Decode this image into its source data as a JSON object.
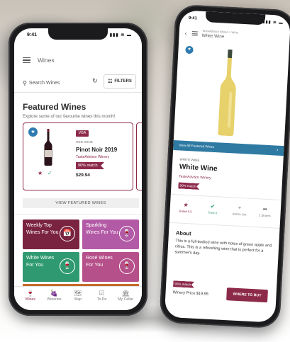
{
  "left_phone": {
    "status": {
      "time": "9:41",
      "icons": "▮▮▮ ≋ ▬"
    },
    "header": {
      "title": "Wines"
    },
    "search": {
      "placeholder": "Search Wines",
      "filters_label": "FILTERS"
    },
    "featured": {
      "title": "Featured Wines",
      "subtitle": "Explore some of our favourite wines this month!",
      "card": {
        "tag": "VGA",
        "type": "RED WINE",
        "name": "Pinot Noir 2019",
        "winery": "TasteAdvisor Winery",
        "match": "90% match",
        "price": "$29.94",
        "bottle_color": "#2b1419"
      },
      "view_button": "VIEW FEATURED WINES"
    },
    "tiles": [
      {
        "label": "Weekly Top Wines For You",
        "icon": "calendar-icon",
        "glyph": "📅",
        "color": "#7a2340"
      },
      {
        "label": "Sparkling Wines For You",
        "icon": "wine-glass-icon",
        "glyph": "🍷",
        "color": "#b35aa6"
      },
      {
        "label": "White Wines For You",
        "icon": "wine-glass-icon",
        "glyph": "🍷",
        "color": "#2f9a72"
      },
      {
        "label": "Rosé Wines For You",
        "icon": "wine-glass-icon",
        "glyph": "🍷",
        "color": "#b6508a"
      }
    ],
    "tabs": [
      {
        "label": "Wines",
        "icon": "wine-icon",
        "glyph": "🍷",
        "active": true
      },
      {
        "label": "Wineries",
        "icon": "winery-icon",
        "glyph": "🍇"
      },
      {
        "label": "Map",
        "icon": "map-icon",
        "glyph": "🗺"
      },
      {
        "label": "To Do",
        "icon": "todo-icon",
        "glyph": "☑"
      },
      {
        "label": "My Cellar",
        "icon": "cellar-icon",
        "glyph": "🏛"
      }
    ]
  },
  "right_phone": {
    "status": {
      "time": "9:41",
      "icons": "▮▮▮ ≋ ▬"
    },
    "header": {
      "breadcrumb": "TasteAdvisor Wines > Wine",
      "title": "White Wine"
    },
    "view_all_bar": "View All Featured Wines",
    "wine": {
      "type": "WHITE WINE",
      "name": "White Wine",
      "winery": "TasteAdvisor Winery",
      "match": "90% match",
      "bottle_color": "#e7d16a"
    },
    "actions": [
      {
        "label": "Rated 5.5",
        "icon": "star-icon",
        "glyph": "★"
      },
      {
        "label": "Tried It",
        "icon": "check-icon",
        "glyph": "✔"
      },
      {
        "label": "Add to List",
        "icon": "plus-icon",
        "glyph": "+"
      },
      {
        "label": "2 Shares",
        "icon": "share-icon",
        "glyph": "➦"
      }
    ],
    "about": {
      "heading": "About",
      "text": "This is a full-bodied wine with notes of green apple and citrus. This is a refreshing wine that is perfect for a summer's day."
    },
    "bottom_match": "90% match",
    "price": "Winery Price $19.95",
    "buy_button": "WHERE TO BUY"
  }
}
